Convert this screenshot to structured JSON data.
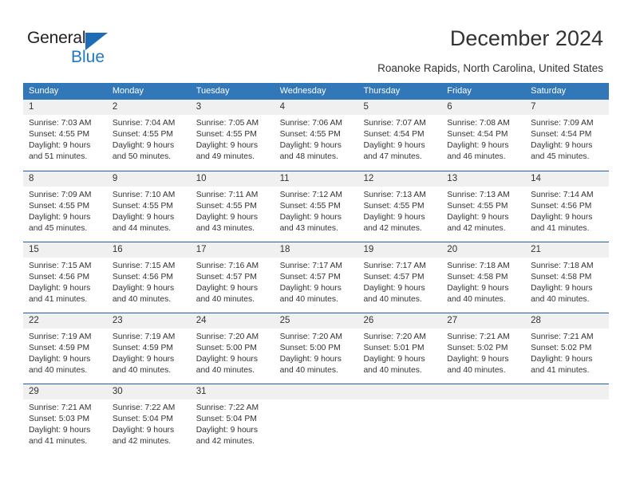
{
  "logo": {
    "word_top": "General",
    "word_bottom": "Blue",
    "triangle_color": "#1e6cb5",
    "blue_color": "#1e78c8"
  },
  "header": {
    "title": "December 2024",
    "subtitle": "Roanoke Rapids, North Carolina, United States"
  },
  "theme": {
    "header_bar": "#3277b8",
    "week_divider": "#1f5fa6",
    "day_band": "#f0f0f0",
    "text": "#333333"
  },
  "calendar": {
    "weekday_headers": [
      "Sunday",
      "Monday",
      "Tuesday",
      "Wednesday",
      "Thursday",
      "Friday",
      "Saturday"
    ],
    "weeks": [
      [
        {
          "day": "1",
          "sunrise": "Sunrise: 7:03 AM",
          "sunset": "Sunset: 4:55 PM",
          "daylight_1": "Daylight: 9 hours",
          "daylight_2": "and 51 minutes."
        },
        {
          "day": "2",
          "sunrise": "Sunrise: 7:04 AM",
          "sunset": "Sunset: 4:55 PM",
          "daylight_1": "Daylight: 9 hours",
          "daylight_2": "and 50 minutes."
        },
        {
          "day": "3",
          "sunrise": "Sunrise: 7:05 AM",
          "sunset": "Sunset: 4:55 PM",
          "daylight_1": "Daylight: 9 hours",
          "daylight_2": "and 49 minutes."
        },
        {
          "day": "4",
          "sunrise": "Sunrise: 7:06 AM",
          "sunset": "Sunset: 4:55 PM",
          "daylight_1": "Daylight: 9 hours",
          "daylight_2": "and 48 minutes."
        },
        {
          "day": "5",
          "sunrise": "Sunrise: 7:07 AM",
          "sunset": "Sunset: 4:54 PM",
          "daylight_1": "Daylight: 9 hours",
          "daylight_2": "and 47 minutes."
        },
        {
          "day": "6",
          "sunrise": "Sunrise: 7:08 AM",
          "sunset": "Sunset: 4:54 PM",
          "daylight_1": "Daylight: 9 hours",
          "daylight_2": "and 46 minutes."
        },
        {
          "day": "7",
          "sunrise": "Sunrise: 7:09 AM",
          "sunset": "Sunset: 4:54 PM",
          "daylight_1": "Daylight: 9 hours",
          "daylight_2": "and 45 minutes."
        }
      ],
      [
        {
          "day": "8",
          "sunrise": "Sunrise: 7:09 AM",
          "sunset": "Sunset: 4:55 PM",
          "daylight_1": "Daylight: 9 hours",
          "daylight_2": "and 45 minutes."
        },
        {
          "day": "9",
          "sunrise": "Sunrise: 7:10 AM",
          "sunset": "Sunset: 4:55 PM",
          "daylight_1": "Daylight: 9 hours",
          "daylight_2": "and 44 minutes."
        },
        {
          "day": "10",
          "sunrise": "Sunrise: 7:11 AM",
          "sunset": "Sunset: 4:55 PM",
          "daylight_1": "Daylight: 9 hours",
          "daylight_2": "and 43 minutes."
        },
        {
          "day": "11",
          "sunrise": "Sunrise: 7:12 AM",
          "sunset": "Sunset: 4:55 PM",
          "daylight_1": "Daylight: 9 hours",
          "daylight_2": "and 43 minutes."
        },
        {
          "day": "12",
          "sunrise": "Sunrise: 7:13 AM",
          "sunset": "Sunset: 4:55 PM",
          "daylight_1": "Daylight: 9 hours",
          "daylight_2": "and 42 minutes."
        },
        {
          "day": "13",
          "sunrise": "Sunrise: 7:13 AM",
          "sunset": "Sunset: 4:55 PM",
          "daylight_1": "Daylight: 9 hours",
          "daylight_2": "and 42 minutes."
        },
        {
          "day": "14",
          "sunrise": "Sunrise: 7:14 AM",
          "sunset": "Sunset: 4:56 PM",
          "daylight_1": "Daylight: 9 hours",
          "daylight_2": "and 41 minutes."
        }
      ],
      [
        {
          "day": "15",
          "sunrise": "Sunrise: 7:15 AM",
          "sunset": "Sunset: 4:56 PM",
          "daylight_1": "Daylight: 9 hours",
          "daylight_2": "and 41 minutes."
        },
        {
          "day": "16",
          "sunrise": "Sunrise: 7:15 AM",
          "sunset": "Sunset: 4:56 PM",
          "daylight_1": "Daylight: 9 hours",
          "daylight_2": "and 40 minutes."
        },
        {
          "day": "17",
          "sunrise": "Sunrise: 7:16 AM",
          "sunset": "Sunset: 4:57 PM",
          "daylight_1": "Daylight: 9 hours",
          "daylight_2": "and 40 minutes."
        },
        {
          "day": "18",
          "sunrise": "Sunrise: 7:17 AM",
          "sunset": "Sunset: 4:57 PM",
          "daylight_1": "Daylight: 9 hours",
          "daylight_2": "and 40 minutes."
        },
        {
          "day": "19",
          "sunrise": "Sunrise: 7:17 AM",
          "sunset": "Sunset: 4:57 PM",
          "daylight_1": "Daylight: 9 hours",
          "daylight_2": "and 40 minutes."
        },
        {
          "day": "20",
          "sunrise": "Sunrise: 7:18 AM",
          "sunset": "Sunset: 4:58 PM",
          "daylight_1": "Daylight: 9 hours",
          "daylight_2": "and 40 minutes."
        },
        {
          "day": "21",
          "sunrise": "Sunrise: 7:18 AM",
          "sunset": "Sunset: 4:58 PM",
          "daylight_1": "Daylight: 9 hours",
          "daylight_2": "and 40 minutes."
        }
      ],
      [
        {
          "day": "22",
          "sunrise": "Sunrise: 7:19 AM",
          "sunset": "Sunset: 4:59 PM",
          "daylight_1": "Daylight: 9 hours",
          "daylight_2": "and 40 minutes."
        },
        {
          "day": "23",
          "sunrise": "Sunrise: 7:19 AM",
          "sunset": "Sunset: 4:59 PM",
          "daylight_1": "Daylight: 9 hours",
          "daylight_2": "and 40 minutes."
        },
        {
          "day": "24",
          "sunrise": "Sunrise: 7:20 AM",
          "sunset": "Sunset: 5:00 PM",
          "daylight_1": "Daylight: 9 hours",
          "daylight_2": "and 40 minutes."
        },
        {
          "day": "25",
          "sunrise": "Sunrise: 7:20 AM",
          "sunset": "Sunset: 5:00 PM",
          "daylight_1": "Daylight: 9 hours",
          "daylight_2": "and 40 minutes."
        },
        {
          "day": "26",
          "sunrise": "Sunrise: 7:20 AM",
          "sunset": "Sunset: 5:01 PM",
          "daylight_1": "Daylight: 9 hours",
          "daylight_2": "and 40 minutes."
        },
        {
          "day": "27",
          "sunrise": "Sunrise: 7:21 AM",
          "sunset": "Sunset: 5:02 PM",
          "daylight_1": "Daylight: 9 hours",
          "daylight_2": "and 40 minutes."
        },
        {
          "day": "28",
          "sunrise": "Sunrise: 7:21 AM",
          "sunset": "Sunset: 5:02 PM",
          "daylight_1": "Daylight: 9 hours",
          "daylight_2": "and 41 minutes."
        }
      ],
      [
        {
          "day": "29",
          "sunrise": "Sunrise: 7:21 AM",
          "sunset": "Sunset: 5:03 PM",
          "daylight_1": "Daylight: 9 hours",
          "daylight_2": "and 41 minutes."
        },
        {
          "day": "30",
          "sunrise": "Sunrise: 7:22 AM",
          "sunset": "Sunset: 5:04 PM",
          "daylight_1": "Daylight: 9 hours",
          "daylight_2": "and 42 minutes."
        },
        {
          "day": "31",
          "sunrise": "Sunrise: 7:22 AM",
          "sunset": "Sunset: 5:04 PM",
          "daylight_1": "Daylight: 9 hours",
          "daylight_2": "and 42 minutes."
        },
        {
          "day": "",
          "sunrise": "",
          "sunset": "",
          "daylight_1": "",
          "daylight_2": ""
        },
        {
          "day": "",
          "sunrise": "",
          "sunset": "",
          "daylight_1": "",
          "daylight_2": ""
        },
        {
          "day": "",
          "sunrise": "",
          "sunset": "",
          "daylight_1": "",
          "daylight_2": ""
        },
        {
          "day": "",
          "sunrise": "",
          "sunset": "",
          "daylight_1": "",
          "daylight_2": ""
        }
      ]
    ]
  }
}
